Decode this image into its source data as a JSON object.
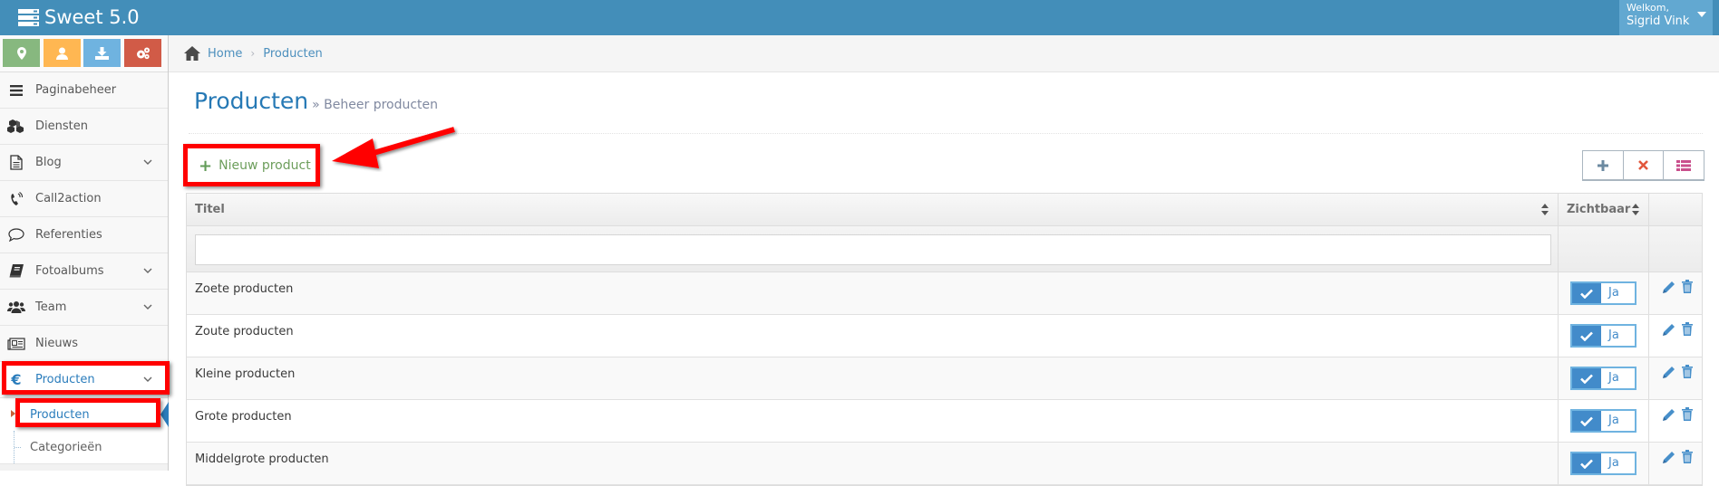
{
  "app": {
    "title": "Sweet 5.0",
    "user": {
      "greeting": "Welkom,",
      "name": "Sigrid Vink"
    }
  },
  "colors": {
    "navbar": "#438eb9",
    "user_box": "#62a8d1",
    "accent": "#2679b5",
    "shortcut_green": "#87b87f",
    "shortcut_orange": "#ffb752",
    "shortcut_blue": "#6fb3e0",
    "shortcut_red": "#d15b47",
    "annotation_red": "#ff0000"
  },
  "shortcuts": [
    {
      "icon": "map-marker-icon"
    },
    {
      "icon": "user-icon"
    },
    {
      "icon": "download-icon"
    },
    {
      "icon": "cogs-icon"
    }
  ],
  "sidebar": {
    "items": [
      {
        "label": "Paginabeheer",
        "icon": "bars-icon",
        "has_submenu": false
      },
      {
        "label": "Diensten",
        "icon": "cubes-icon",
        "has_submenu": false
      },
      {
        "label": "Blog",
        "icon": "file-text-icon",
        "has_submenu": true
      },
      {
        "label": "Call2action",
        "icon": "phone-volume-icon",
        "has_submenu": false
      },
      {
        "label": "Referenties",
        "icon": "comment-icon",
        "has_submenu": false
      },
      {
        "label": "Fotoalbums",
        "icon": "book-icon",
        "has_submenu": true
      },
      {
        "label": "Team",
        "icon": "users-icon",
        "has_submenu": true
      },
      {
        "label": "Nieuws",
        "icon": "newspaper-icon",
        "has_submenu": false
      },
      {
        "label": "Producten",
        "icon": "euro-icon",
        "has_submenu": true,
        "active": true
      }
    ],
    "submenu": [
      {
        "label": "Producten",
        "active": true
      },
      {
        "label": "Categorieën",
        "active": false
      }
    ]
  },
  "breadcrumb": {
    "home": "Home",
    "current": "Producten"
  },
  "page": {
    "title": "Producten",
    "subtitle": "» Beheer producten"
  },
  "toolbar": {
    "new_label": "Nieuw product",
    "actions": [
      {
        "name": "add",
        "icon": "plus-icon"
      },
      {
        "name": "remove",
        "icon": "times-icon"
      },
      {
        "name": "list",
        "icon": "list-icon"
      }
    ]
  },
  "table": {
    "columns": [
      {
        "label": "Titel",
        "sortable": true
      },
      {
        "label": "Zichtbaar",
        "sortable": true
      },
      {
        "label": "",
        "sortable": false
      }
    ],
    "filter": {
      "value": "",
      "placeholder": ""
    },
    "rows": [
      {
        "title": "Zoete producten",
        "visible": "Ja"
      },
      {
        "title": "Zoute producten",
        "visible": "Ja"
      },
      {
        "title": "Kleine producten",
        "visible": "Ja"
      },
      {
        "title": "Grote producten",
        "visible": "Ja"
      },
      {
        "title": "Middelgrote producten",
        "visible": "Ja"
      }
    ]
  }
}
